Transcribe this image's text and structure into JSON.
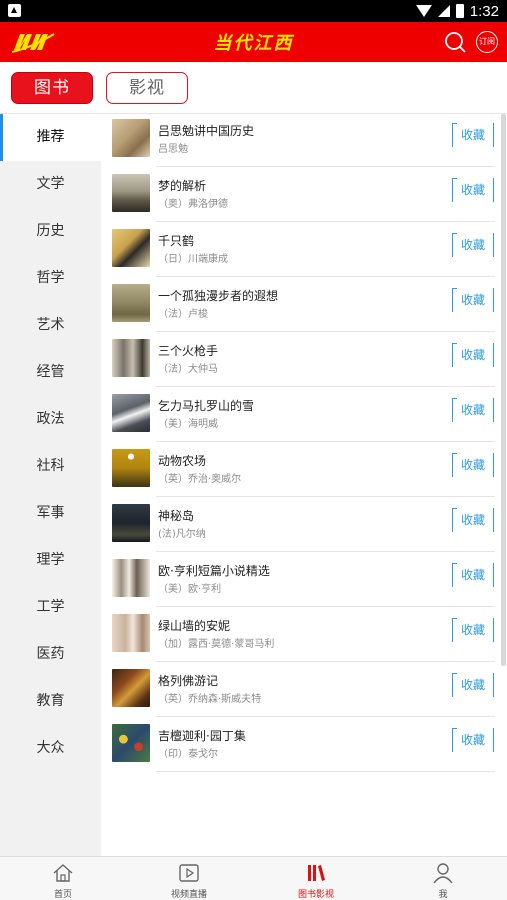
{
  "status_bar": {
    "time": "1:32"
  },
  "header": {
    "title": "当代江西",
    "subscribe_label": "订阅",
    "accent": "#ee0000",
    "title_color": "#ffe300"
  },
  "tabs": [
    {
      "label": "图书",
      "active": true
    },
    {
      "label": "影视",
      "active": false
    }
  ],
  "sidebar": {
    "items": [
      {
        "label": "推荐",
        "active": true
      },
      {
        "label": "文学"
      },
      {
        "label": "历史"
      },
      {
        "label": "哲学"
      },
      {
        "label": "艺术"
      },
      {
        "label": "经管"
      },
      {
        "label": "政法"
      },
      {
        "label": "社科"
      },
      {
        "label": "军事"
      },
      {
        "label": "理学"
      },
      {
        "label": "工学"
      },
      {
        "label": "医药"
      },
      {
        "label": "教育"
      },
      {
        "label": "大众"
      }
    ]
  },
  "books": [
    {
      "title": "吕思勉讲中国历史",
      "author": "吕思勉",
      "action": "收藏"
    },
    {
      "title": "梦的解析",
      "author": "（奥）弗洛伊德",
      "action": "收藏"
    },
    {
      "title": "千只鹤",
      "author": "（日）川端康成",
      "action": "收藏"
    },
    {
      "title": "一个孤独漫步者的遐想",
      "author": "（法）卢梭",
      "action": "收藏"
    },
    {
      "title": "三个火枪手",
      "author": "（法）大仲马",
      "action": "收藏"
    },
    {
      "title": "乞力马扎罗山的雪",
      "author": "（美）海明威",
      "action": "收藏"
    },
    {
      "title": "动物农场",
      "author": "（英）乔治·奥威尔",
      "action": "收藏"
    },
    {
      "title": "神秘岛",
      "author": "(法)凡尔纳",
      "action": "收藏"
    },
    {
      "title": "欧·亨利短篇小说精选",
      "author": "（美）欧·亨利",
      "action": "收藏"
    },
    {
      "title": "绿山墙的安妮",
      "author": "（加）露西·莫德·蒙哥马利",
      "action": "收藏"
    },
    {
      "title": "格列佛游记",
      "author": "（英）乔纳森·斯威夫特",
      "action": "收藏"
    },
    {
      "title": "吉檀迦利·园丁集",
      "author": "（印）泰戈尔",
      "action": "收藏"
    }
  ],
  "bottom_nav": [
    {
      "label": "首页",
      "icon": "home-icon"
    },
    {
      "label": "视频直播",
      "icon": "video-play-icon"
    },
    {
      "label": "图书影视",
      "icon": "books-icon",
      "active": true
    },
    {
      "label": "我",
      "icon": "user-icon"
    }
  ],
  "colors": {
    "collect": "#2b9bea",
    "active_tab": "#e8121c",
    "sidebar_active_bar": "#1e8ee8"
  }
}
